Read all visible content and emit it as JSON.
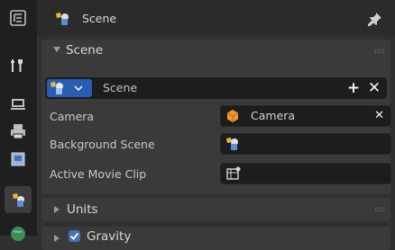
{
  "header": {
    "title": "Scene",
    "icon": "scene-icon",
    "pin_icon": "pin-icon"
  },
  "tabs": [
    {
      "name": "outliner-icon",
      "active": false
    },
    {
      "name": "tool-icon",
      "active": false
    },
    {
      "name": "render-icon",
      "active": false
    },
    {
      "name": "output-icon",
      "active": false
    },
    {
      "name": "view-layer-icon",
      "active": false
    },
    {
      "name": "scene-icon",
      "active": true
    },
    {
      "name": "world-icon",
      "active": false
    }
  ],
  "scene_panel": {
    "title": "Scene",
    "expanded": true,
    "selector": {
      "value": "Scene",
      "add_label": "+",
      "remove_label": "✕"
    },
    "properties": [
      {
        "label": "Camera",
        "value": "Camera",
        "icon": "camera-object-icon",
        "clear": "✕"
      },
      {
        "label": "Background Scene",
        "value": "",
        "icon": "scene-icon"
      },
      {
        "label": "Active Movie Clip",
        "value": "",
        "icon": "movie-clip-icon"
      }
    ]
  },
  "units_panel": {
    "title": "Units",
    "expanded": false
  },
  "gravity_panel": {
    "title": "Gravity",
    "expanded": false,
    "checked": true
  },
  "colors": {
    "accent": "#285db3",
    "checkbox": "#4772b3",
    "camera_icon": "#f0962a"
  }
}
